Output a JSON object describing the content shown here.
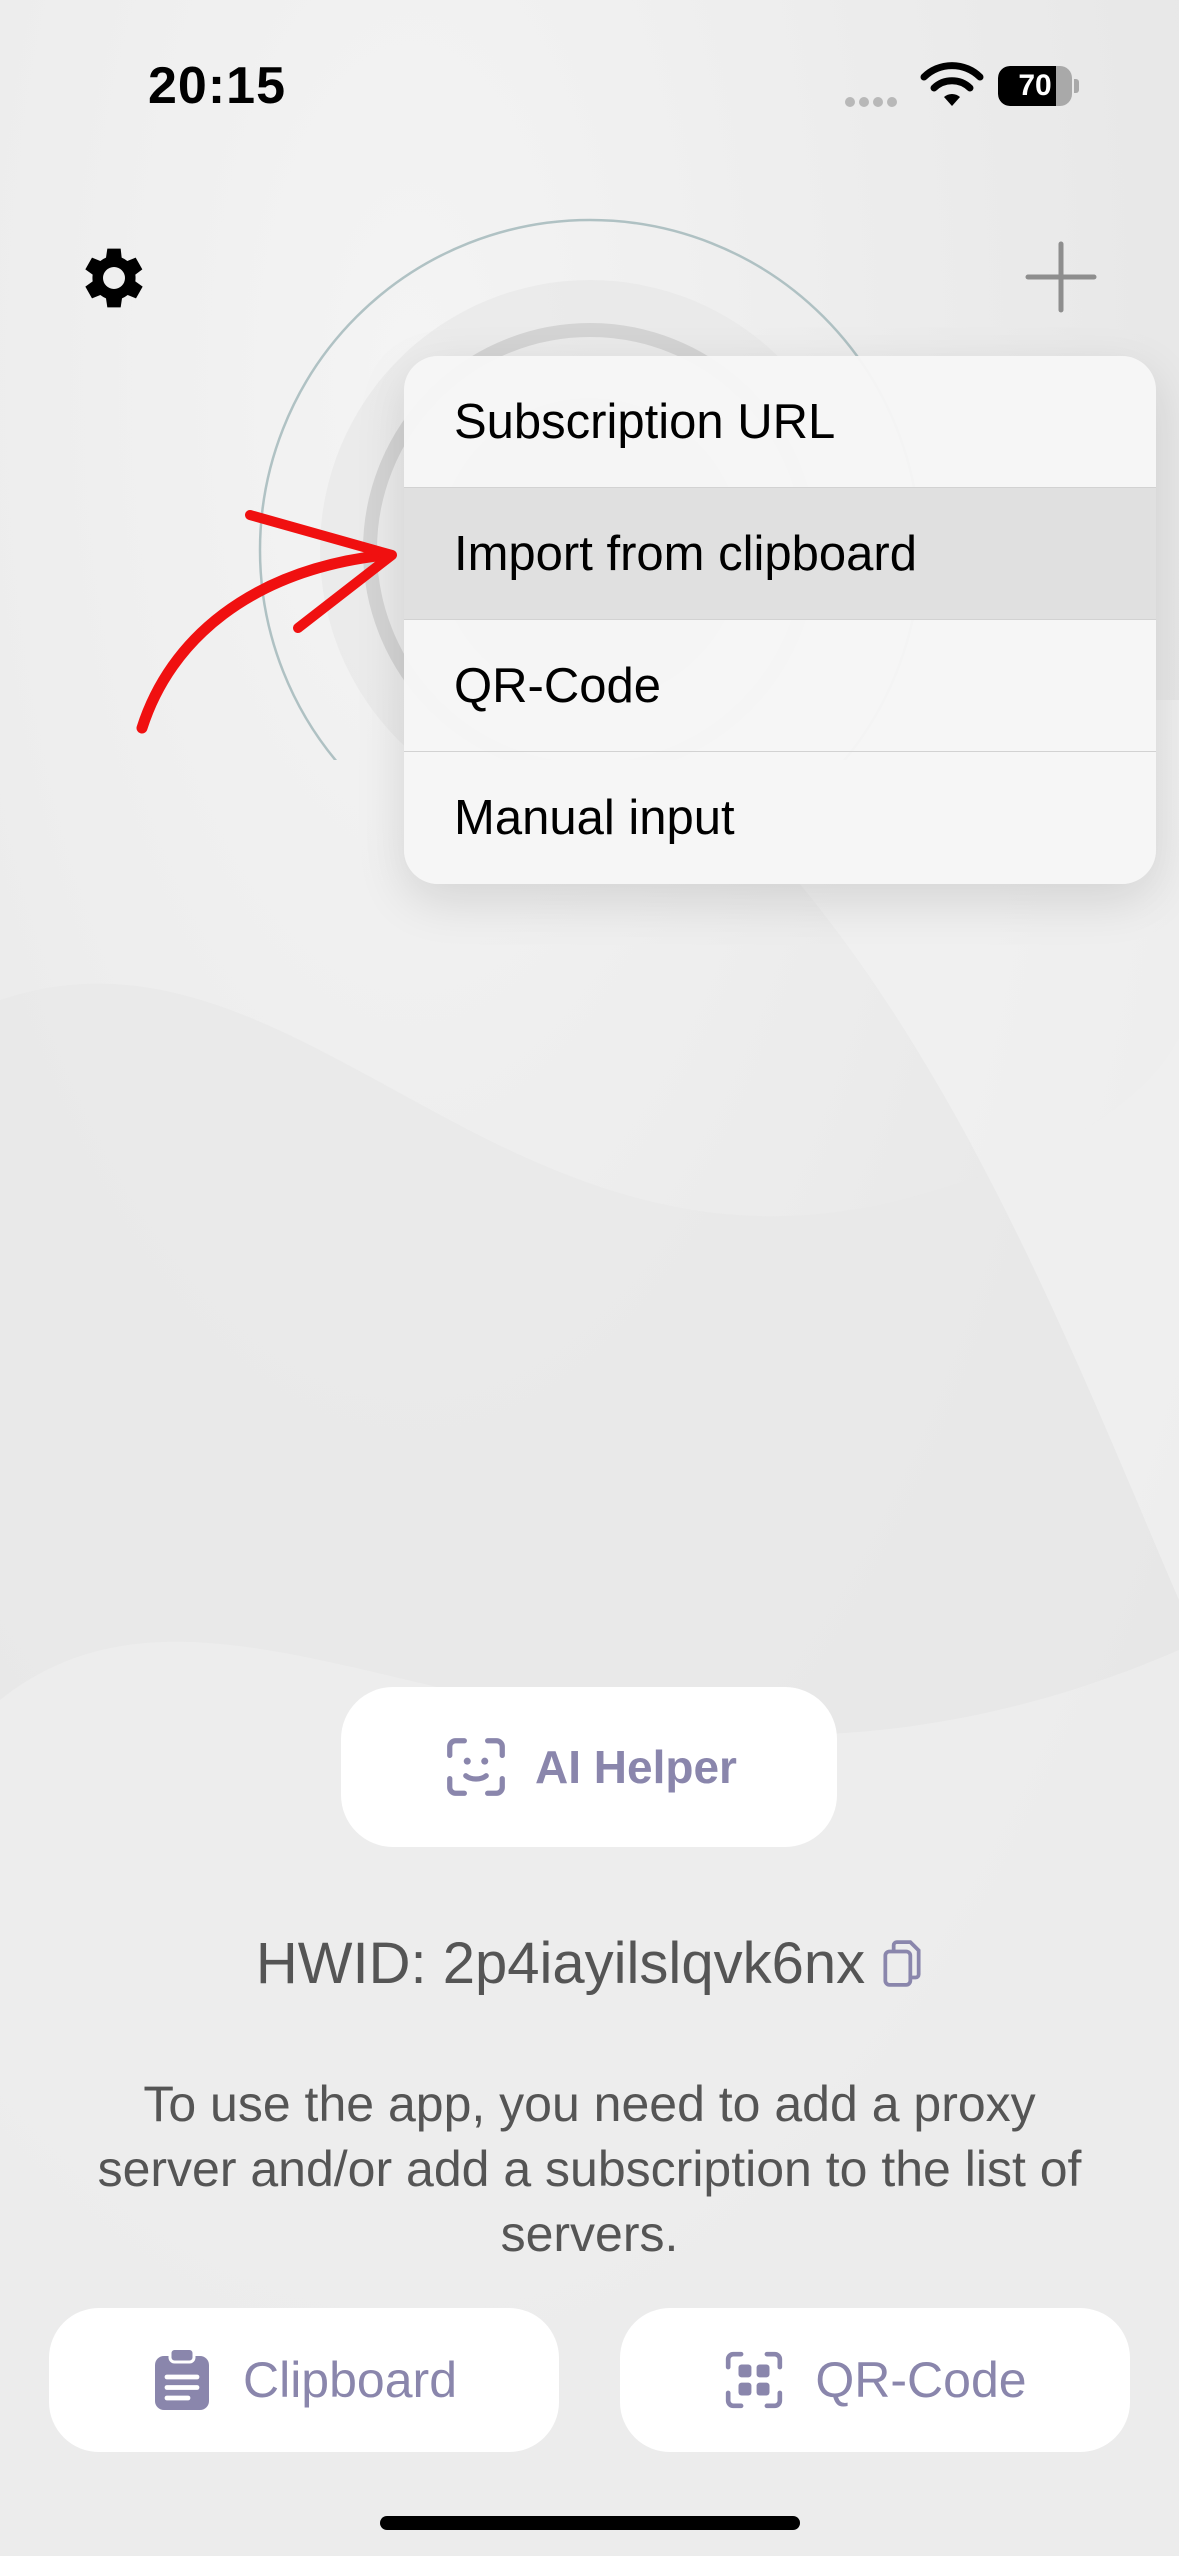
{
  "status_bar": {
    "time": "20:15",
    "battery": "70"
  },
  "menu": {
    "items": [
      {
        "label": "Subscription URL"
      },
      {
        "label": "Import from clipboard"
      },
      {
        "label": "QR-Code"
      },
      {
        "label": "Manual input"
      }
    ]
  },
  "ai_helper": {
    "label": "AI Helper"
  },
  "hwid": {
    "text": "HWID: 2p4iayilslqvk6nx"
  },
  "info": {
    "text": "To use the app, you need to add a proxy server and/or add a subscription to the list of servers."
  },
  "bottom": {
    "clipboard_label": "Clipboard",
    "qr_label": "QR-Code"
  },
  "colors": {
    "accent": "#8a86ac",
    "arrow": "#f01010"
  },
  "icons": [
    "gear-icon",
    "plus-icon",
    "wifi-icon",
    "battery-icon",
    "face-scan-icon",
    "copy-icon",
    "clipboard-icon",
    "qr-code-icon"
  ]
}
